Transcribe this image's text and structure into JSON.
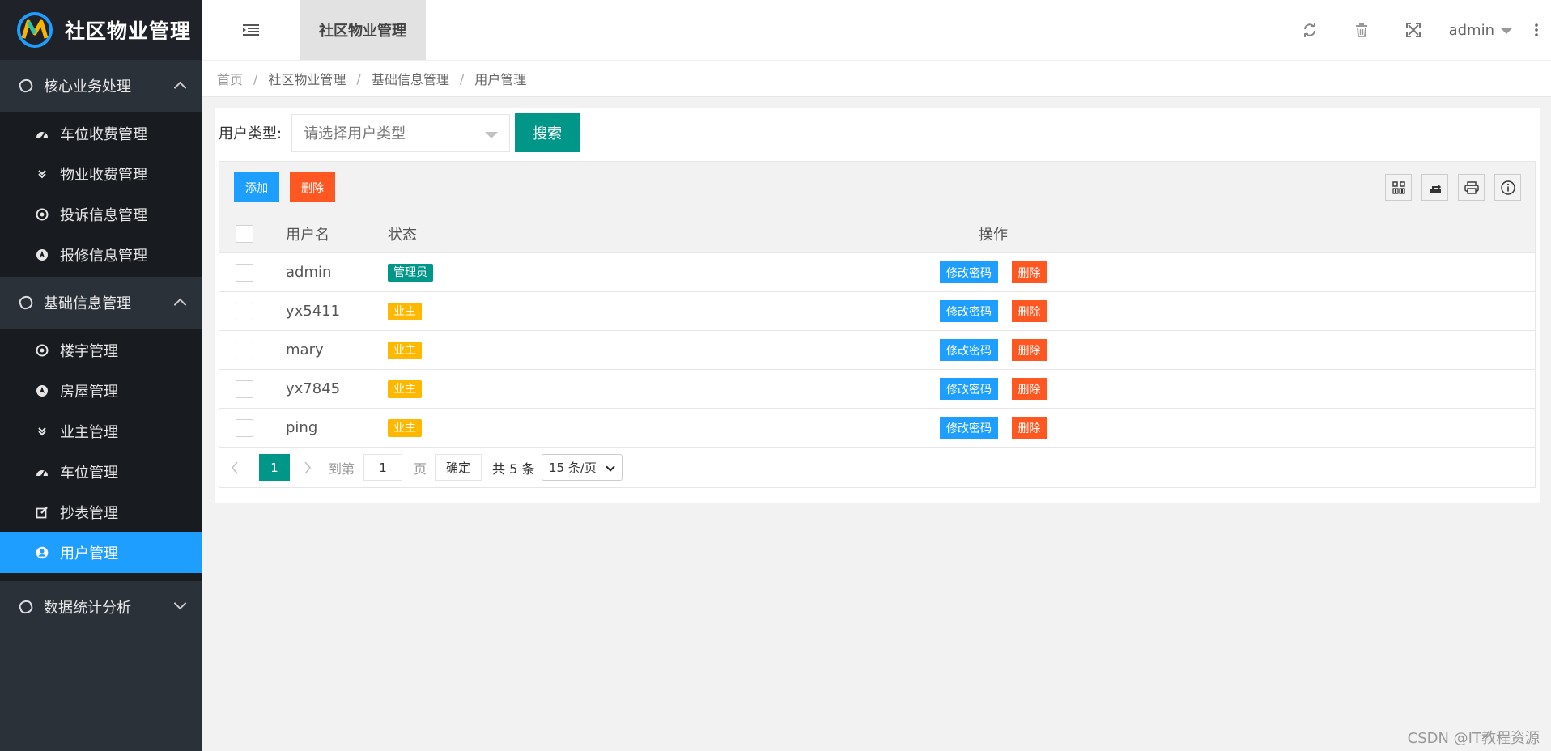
{
  "app": {
    "title": "社区物业管理"
  },
  "sidebar": {
    "groups": [
      {
        "label": "核心业务处理",
        "expanded": true,
        "items": [
          {
            "label": "车位收费管理",
            "icon": "dashboard-icon"
          },
          {
            "label": "物业收费管理",
            "icon": "double-chevron-icon"
          },
          {
            "label": "投诉信息管理",
            "icon": "target-icon"
          },
          {
            "label": "报修信息管理",
            "icon": "compass-icon"
          }
        ]
      },
      {
        "label": "基础信息管理",
        "expanded": true,
        "items": [
          {
            "label": "楼宇管理",
            "icon": "target-icon"
          },
          {
            "label": "房屋管理",
            "icon": "compass-icon"
          },
          {
            "label": "业主管理",
            "icon": "double-chevron-icon"
          },
          {
            "label": "车位管理",
            "icon": "dashboard-icon"
          },
          {
            "label": "抄表管理",
            "icon": "edit-icon"
          },
          {
            "label": "用户管理",
            "icon": "user-circle-icon",
            "active": true
          }
        ]
      },
      {
        "label": "数据统计分析",
        "expanded": false
      }
    ]
  },
  "header": {
    "tab": "社区物业管理",
    "user": "admin"
  },
  "breadcrumb": [
    "首页",
    "社区物业管理",
    "基础信息管理",
    "用户管理"
  ],
  "search": {
    "label": "用户类型:",
    "placeholder": "请选择用户类型",
    "button": "搜索"
  },
  "toolbar": {
    "add": "添加",
    "delete": "删除"
  },
  "table": {
    "columns": [
      "用户名",
      "状态",
      "操作"
    ],
    "rows": [
      {
        "username": "admin",
        "status": "管理员",
        "status_type": "admin"
      },
      {
        "username": "yx5411",
        "status": "业主",
        "status_type": "owner"
      },
      {
        "username": "mary",
        "status": "业主",
        "status_type": "owner"
      },
      {
        "username": "yx7845",
        "status": "业主",
        "status_type": "owner"
      },
      {
        "username": "ping",
        "status": "业主",
        "status_type": "owner"
      }
    ],
    "actions": {
      "change_password": "修改密码",
      "delete": "删除"
    }
  },
  "pagination": {
    "current_page": "1",
    "goto_label": "到第",
    "page_input": "1",
    "page_suffix": "页",
    "confirm": "确定",
    "total": "共 5 条",
    "page_size": "15 条/页"
  },
  "colors": {
    "sidebar_bg": "#2a3139",
    "active": "#1e9fff",
    "primary": "#009688",
    "danger": "#ff5722",
    "warning": "#ffb800"
  },
  "watermark": "CSDN @IT教程资源"
}
